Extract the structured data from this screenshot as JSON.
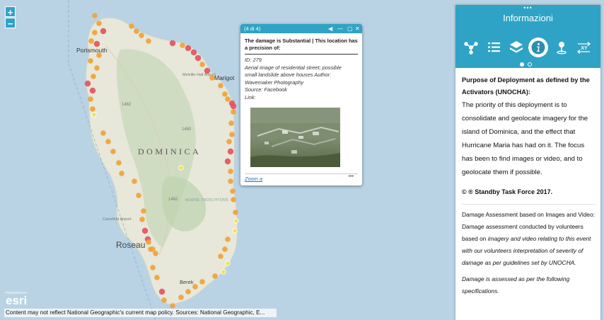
{
  "map": {
    "island_label": "DOMINICA",
    "place_labels": [
      "Portsmouth",
      "Marigot",
      "Melville Hall Airport",
      "1482",
      "1480",
      "1482",
      "MORNE TROIS PITONS",
      "Canefield Airport",
      "Roseau",
      "Berek"
    ],
    "zoom_in": "+",
    "zoom_out": "−"
  },
  "popup": {
    "counter": "(4 di 4)",
    "title": "The damage is Substantial | This location has a precision of:",
    "lines": [
      "ID: 279",
      "Aerial image of residential street; possible",
      "small landslide above houses Author:",
      "Wavemaker Photography",
      "Source: Facebook",
      "Link:"
    ],
    "zoom_link": "Zoom a",
    "menu": "•••"
  },
  "panel": {
    "dots": "•••",
    "title": "Informazioni",
    "tools": [
      "share-icon",
      "legend-icon",
      "layers-icon",
      "info-icon",
      "locate-icon",
      "coordinates-icon"
    ],
    "coordinates_label": "XY",
    "active_tool": "info-icon",
    "paragraphs": {
      "heading": "Purpose of Deployment as defined by the Activators (UNOCHA):",
      "body": "The priority of this deployment is to consolidate and geolocate imagery for the island of Dominica, and the effect that Hurricane Maria has had on it. The focus has been to find images or video, and to geolocate them if possible.",
      "copyright": "© ® Standby Task Force 2017.",
      "assessment_a": "Damage Assessment based on Images and Video: Damage assessment conducted by volunteers based on ",
      "assessment_b": "imagery and video relating to this event with our volunteers interpretation of severity of damage as per guidelines set by UNOCHA.",
      "specs": "Damage is assessed as per the following specifications."
    }
  },
  "footer": {
    "attribution": "Content may not reflect National Geographic's current map policy. Sources: National Geographic, E...",
    "logo_small": "POWERED BY",
    "logo_big": "esri"
  },
  "colors": {
    "accent": "#2fa3c6",
    "sea": "#b9d3e4",
    "land": "#e7e7da",
    "severe": "#e4545c",
    "substantial": "#f0a338",
    "minor": "#f3e23c"
  }
}
